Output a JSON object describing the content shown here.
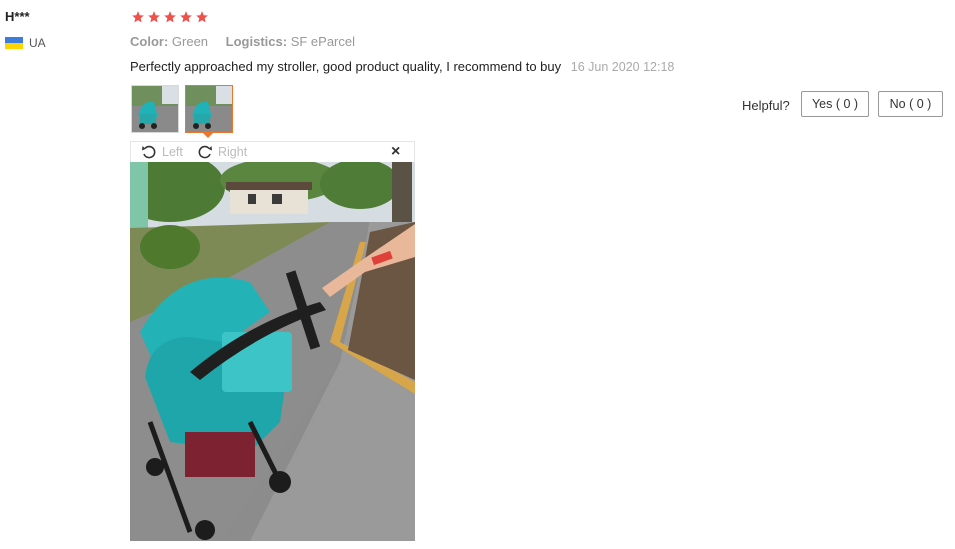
{
  "review": {
    "username": "H***",
    "country_code": "UA",
    "rating": 5,
    "color_label": "Color:",
    "color_value": "Green",
    "logistics_label": "Logistics:",
    "logistics_value": "SF eParcel",
    "text": "Perfectly approached my stroller, good product quality, I recommend to buy",
    "date": "16 Jun 2020 12:18"
  },
  "helpful": {
    "label": "Helpful?",
    "yes_label": "Yes ( 0 )",
    "no_label": "No ( 0 )"
  },
  "viewer": {
    "rotate_left_label": "Left",
    "rotate_right_label": "Right",
    "close_glyph": "×",
    "selected_thumbnail_index": 1
  },
  "colors": {
    "star": "#f0504a",
    "accent": "#f0742a",
    "flag_blue": "#3b7dd8",
    "flag_yellow": "#ffd500"
  },
  "icons": [
    "star-icon",
    "flag-ua-icon",
    "rotate-left-icon",
    "rotate-right-icon",
    "close-icon"
  ]
}
